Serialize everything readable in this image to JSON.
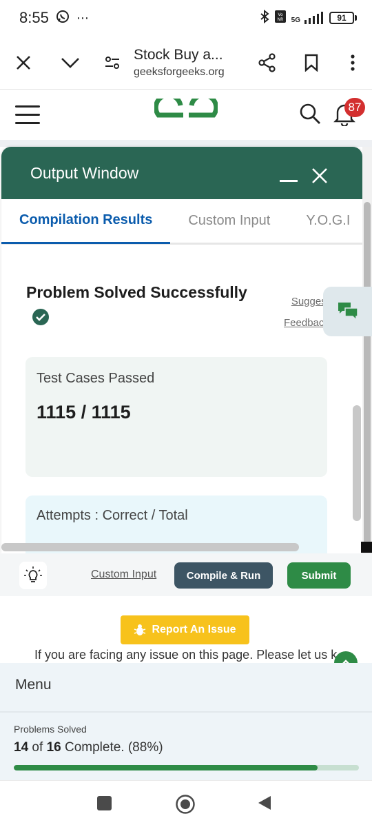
{
  "status_bar": {
    "time": "8:55",
    "battery": "91",
    "network": "5G"
  },
  "browser": {
    "title": "Stock Buy a...",
    "domain": "geeksforgeeks.org"
  },
  "site": {
    "notifications": "87"
  },
  "output_window": {
    "title": "Output Window",
    "tabs": [
      "Compilation Results",
      "Custom Input",
      "Y.O.G.I"
    ],
    "status": "Problem Solved Successfully",
    "links": [
      "Suggest",
      "Feedback"
    ],
    "test_cases_label": "Test Cases Passed",
    "test_cases_value": "1115 / 1115",
    "attempts_label": "Attempts : Correct / Total"
  },
  "actions": {
    "custom_input": "Custom Input",
    "compile_run": "Compile & Run",
    "submit": "Submit"
  },
  "report": {
    "button": "Report An Issue",
    "text": "If you are facing any issue on this page. Please let us know."
  },
  "menu": {
    "title": "Menu",
    "progress_label": "Problems Solved",
    "solved": "14",
    "of_word": "of",
    "total": "16",
    "suffix": "Complete. (88%)",
    "progress_fraction": 0.88
  },
  "colors": {
    "brand_green": "#2e8b46",
    "header_green": "#2a6654",
    "tab_blue": "#0b5cad"
  }
}
